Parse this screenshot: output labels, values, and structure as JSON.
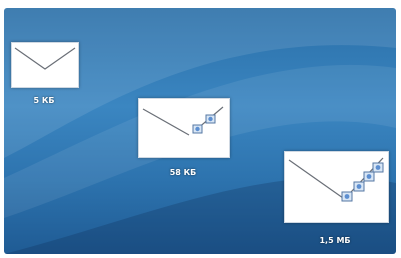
{
  "items": [
    {
      "name": "small-message",
      "size_label": "5 КБ",
      "attachments": 0
    },
    {
      "name": "medium-message",
      "size_label": "58 КБ",
      "attachments": 2
    },
    {
      "name": "large-message",
      "size_label": "1,5 МБ",
      "attachments": 4
    }
  ],
  "colors": {
    "background": "#2f7ab8",
    "envelope": "#ffffff",
    "label": "#ffffff"
  },
  "icons": {
    "envelope": "envelope-icon",
    "attachment": "attachment-icon"
  }
}
